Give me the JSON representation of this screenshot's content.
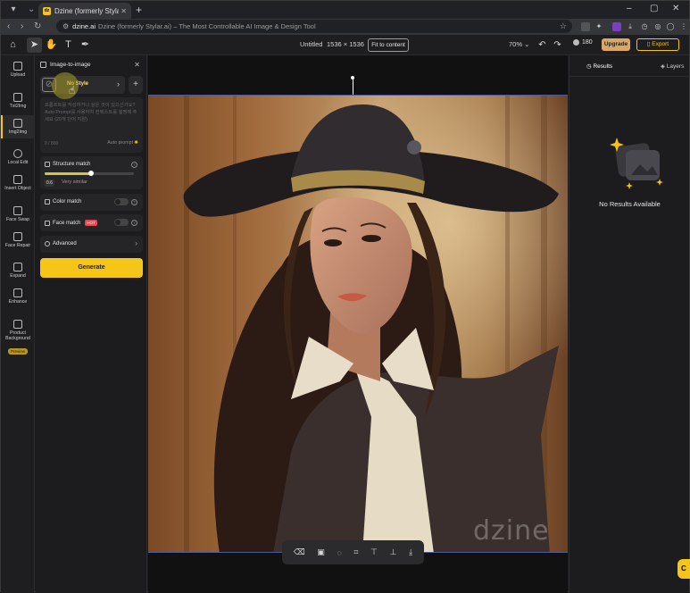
{
  "browser": {
    "tab_title": "Dzine (formerly Stylar.ai) - The",
    "tab_favicon": "dz",
    "address_site": "dzine.ai",
    "address_rest": "Dzine (formerly Stylar.ai) – The Most Controllable AI Image & Design Tool"
  },
  "toolbar": {
    "doc_title": "Untitled",
    "doc_size": "1536 × 1536",
    "fit_label": "Fit to content",
    "zoom": "70%",
    "credits": "180",
    "upgrade_label": "Upgrade",
    "export_label": "Export"
  },
  "leftnav": {
    "items": [
      {
        "label": "Upload"
      },
      {
        "label": "Txt2Img"
      },
      {
        "label": "Img2Img"
      },
      {
        "label": "Local Edit"
      },
      {
        "label": "Insert Object"
      },
      {
        "label": "Face Swap"
      },
      {
        "label": "Face Repair"
      },
      {
        "label": "Expand"
      },
      {
        "label": "Enhance"
      },
      {
        "label": "Product Background"
      }
    ],
    "preview_badge": "Preview"
  },
  "panel": {
    "title": "Image-to-image",
    "style_name": "No Style",
    "prompt_placeholder": "프롬프트를 작성하거나 싶은 것이 있으신가요? Auto Prompt를 사용하여 컨텍스트를 설명해 주세요 (20개 단어 지원)",
    "prompt_count": "0 / 800",
    "auto_prompt_label": "Auto prompt",
    "structure_match_label": "Structure match",
    "structure_value": "0.6",
    "structure_desc": "Very similar",
    "color_match_label": "Color match",
    "face_match_label": "Face match",
    "hot_badge": "HOT",
    "advanced_label": "Advanced",
    "generate_label": "Generate"
  },
  "canvas": {
    "watermark": "dzine"
  },
  "rightpanel": {
    "results_label": "Results",
    "layers_label": "Layers",
    "empty_text": "No Results Available"
  },
  "colors": {
    "accent": "#f5c518",
    "upgrade": "#d9a76a",
    "hot": "#e5484d"
  }
}
